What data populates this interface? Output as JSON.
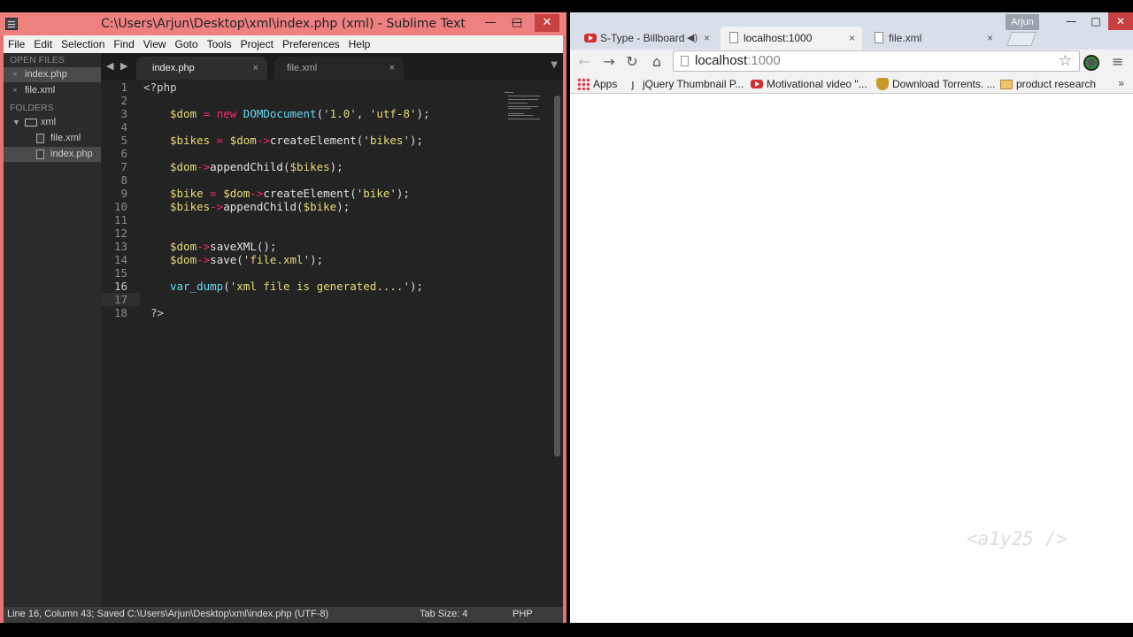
{
  "sublime": {
    "title": "C:\\Users\\Arjun\\Desktop\\xml\\index.php (xml) - Sublime Text",
    "window_controls": {
      "minimize": "—",
      "maximize": "□",
      "close": "✕"
    },
    "menu": [
      "File",
      "Edit",
      "Selection",
      "Find",
      "View",
      "Goto",
      "Tools",
      "Project",
      "Preferences",
      "Help"
    ],
    "sidebar": {
      "open_files_header": "OPEN FILES",
      "open_files": [
        "index.php",
        "file.xml"
      ],
      "folders_header": "FOLDERS",
      "folder": "xml",
      "folder_files": [
        "file.xml",
        "index.php"
      ]
    },
    "tabs": [
      {
        "label": "index.php",
        "close": "×"
      },
      {
        "label": "file.xml",
        "close": "×"
      }
    ],
    "nav": {
      "back": "◀",
      "forward": "▶",
      "dropdown": "▼"
    },
    "line_numbers": [
      "1",
      "2",
      "3",
      "4",
      "5",
      "6",
      "7",
      "8",
      "9",
      "10",
      "11",
      "12",
      "13",
      "14",
      "15",
      "16",
      "17",
      "18"
    ],
    "code": {
      "l1": "<?php",
      "l3": [
        "$dom",
        " = ",
        "new",
        " ",
        "DOMDocument",
        "('",
        "1.0",
        "', '",
        "utf-8",
        "');"
      ],
      "l5": [
        "$bikes",
        " = ",
        "$dom",
        "->",
        "createElement",
        "('",
        "bikes",
        "');"
      ],
      "l7": [
        "$dom",
        "->",
        "appendChild",
        "(",
        "$bikes",
        ");"
      ],
      "l9": [
        "$bike",
        " = ",
        "$dom",
        "->",
        "createElement",
        "('",
        "bike",
        "');"
      ],
      "l10": [
        "$bikes",
        "->",
        "appendChild",
        "(",
        "$bike",
        ");"
      ],
      "l13": [
        "$dom",
        "->",
        "saveXML",
        "();"
      ],
      "l14": [
        "$dom",
        "->",
        "save",
        "('",
        "file.xml",
        "');"
      ],
      "l16": [
        "var_dump",
        "('",
        "xml file is generated....",
        "');"
      ],
      "l18": "?>"
    },
    "status": {
      "left": "Line 16, Column 43; Saved C:\\Users\\Arjun\\Desktop\\xml\\index.php (UTF-8)",
      "tab_size": "Tab Size: 4",
      "syntax": "PHP"
    }
  },
  "chrome": {
    "user": "Arjun",
    "window_controls": {
      "minimize": "—",
      "maximize": "□",
      "close": "✕"
    },
    "tabs": [
      {
        "label": "S-Type - Billboard",
        "close": "×",
        "icon": "youtube-icon",
        "extra": "◀)"
      },
      {
        "label": "localhost:1000",
        "close": "×",
        "icon": "page-icon"
      },
      {
        "label": "file.xml",
        "close": "×",
        "icon": "page-icon"
      }
    ],
    "toolbar": {
      "back": "←",
      "forward": "→",
      "reload": "↻",
      "home": "⌂",
      "star": "☆",
      "menu": "≡"
    },
    "url": {
      "host": "localhost",
      "port": ":1000"
    },
    "bookmarks": [
      {
        "label": "Apps",
        "icon": "apps-icon"
      },
      {
        "label": "jQuery Thumbnail P...",
        "icon": "jquery-icon"
      },
      {
        "label": "Motivational video \"...",
        "icon": "youtube-icon"
      },
      {
        "label": "Download Torrents. ...",
        "icon": "shield-icon"
      },
      {
        "label": "product research",
        "icon": "folder-icon"
      }
    ],
    "bookmarks_more": "»",
    "watermark": "<a1y25 />"
  }
}
